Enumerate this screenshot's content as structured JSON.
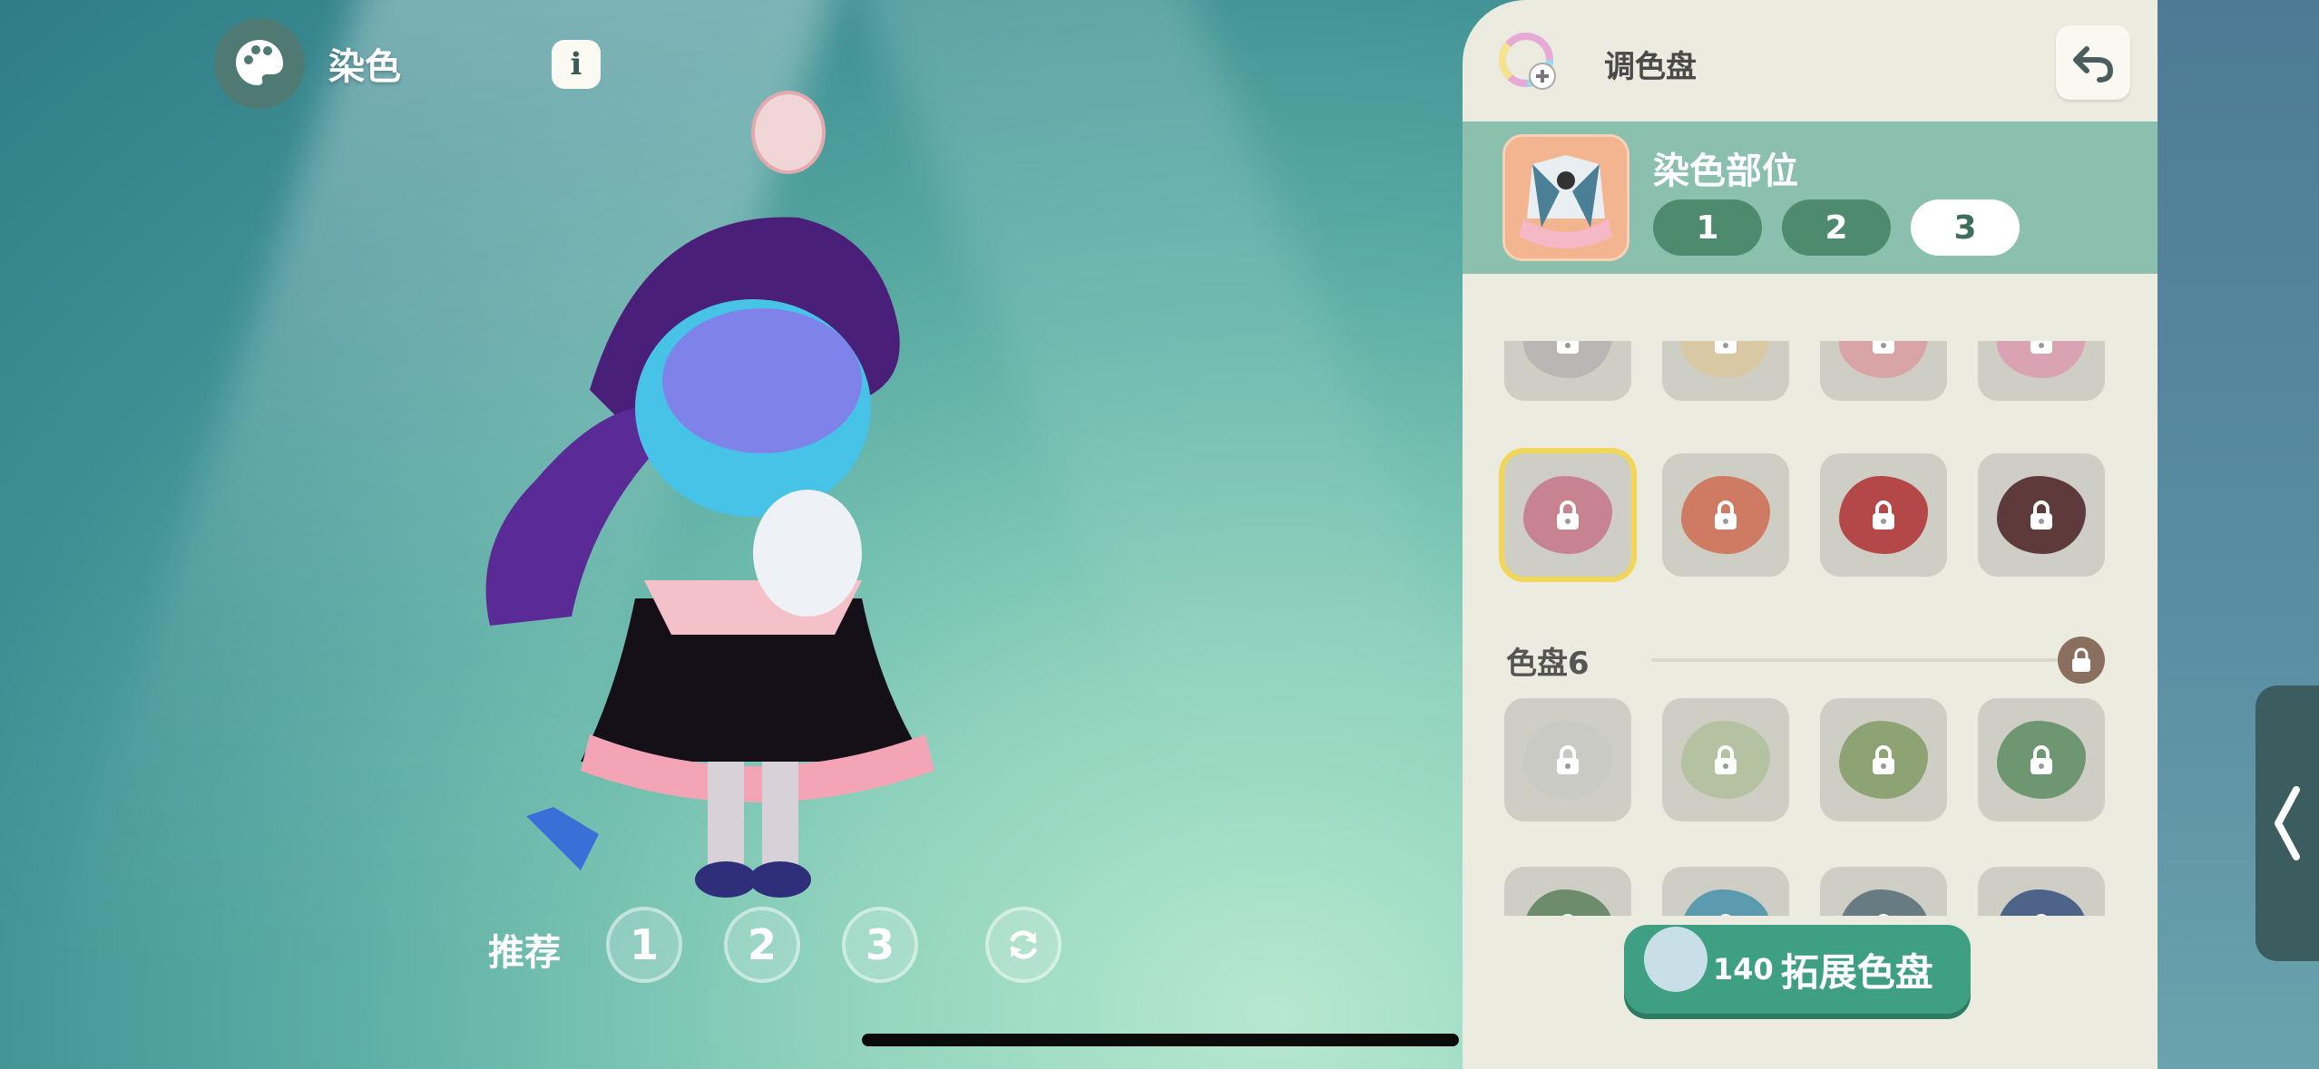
{
  "header": {
    "title": "染色",
    "info_label": "i"
  },
  "recommend": {
    "label": "推荐",
    "options": [
      "1",
      "2",
      "3"
    ]
  },
  "panel": {
    "title": "调色盘",
    "part": {
      "title": "染色部位",
      "tabs": [
        "1",
        "2",
        "3"
      ],
      "active_tab": "3"
    },
    "rows": [
      {
        "colors": [
          "#b9b7b5",
          "#d8c9a4",
          "#d8a4a6",
          "#d9a3b3"
        ],
        "locked": true
      },
      {
        "colors": [
          "#c7838f",
          "#cf7a62",
          "#b44747",
          "#5e3a3b"
        ],
        "locked": true,
        "selected_index": 0
      },
      {
        "colors": [
          "#c9cac4",
          "#b5c2a1",
          "#8ea374",
          "#6e9670"
        ],
        "locked": true
      },
      {
        "colors": [
          "#6c8c6b",
          "#5c9ab0",
          "#667c82",
          "#4d6388"
        ],
        "locked": true
      }
    ],
    "section": {
      "label": "色盘6"
    },
    "expand": {
      "cost": "140",
      "label": "拓展色盘"
    }
  },
  "colors": {
    "panel_bg": "#ecebdf",
    "part_bar": "#8bbfae",
    "accent_green": "#3f9f82",
    "select_yellow": "#f2d659"
  }
}
